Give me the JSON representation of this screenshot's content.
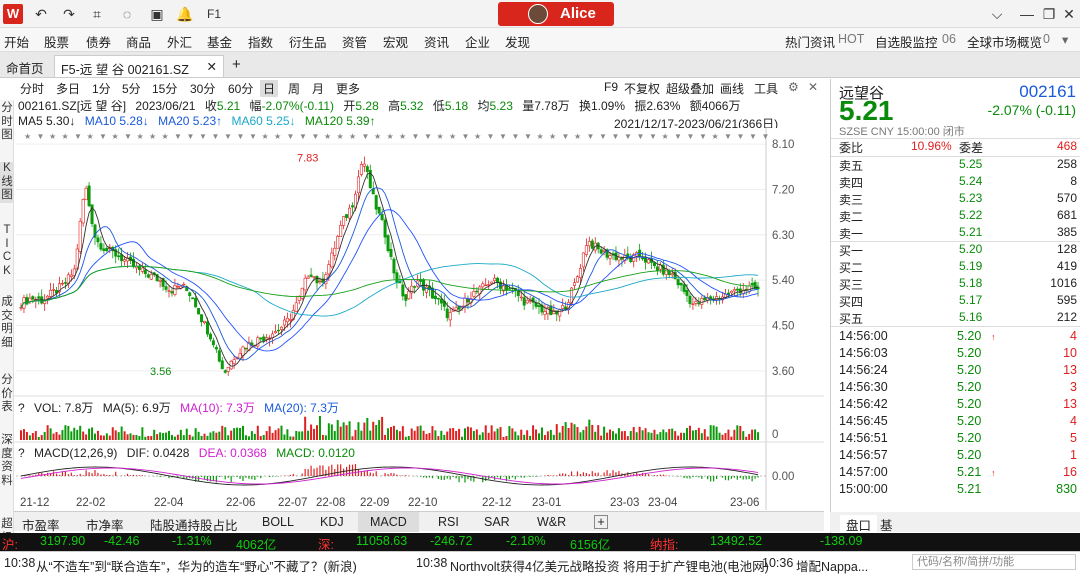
{
  "title_bar": {
    "logo": "W",
    "user_name": "Alice",
    "icons": [
      "undo-icon",
      "redo-icon",
      "crop-icon",
      "chat-icon",
      "window-icon",
      "bell-icon",
      "f1-icon"
    ],
    "f1_label": "F1"
  },
  "menu": {
    "items": [
      "开始",
      "股票",
      "债券",
      "商品",
      "外汇",
      "基金",
      "指数",
      "衍生品",
      "资管",
      "宏观",
      "资讯",
      "企业",
      "发现"
    ],
    "right": [
      "热门资讯",
      "HOT",
      "自选股监控",
      "06",
      "全球市场概览",
      "0"
    ]
  },
  "tabs": {
    "home": "命首页",
    "active": "F5-远 望 谷 002161.SZ",
    "add": "+"
  },
  "left_sidebar": [
    "分\n时\n图",
    "K\n线\n图",
    "T\nI\nC\nK",
    "成\n交\n明\n细",
    "分\n价\n表",
    "深\n度\n资\n料",
    "超\n级"
  ],
  "periods": [
    "分时",
    "多日",
    "1分",
    "5分",
    "15分",
    "30分",
    "60分",
    "日",
    "周",
    "月",
    "更多"
  ],
  "active_period": "日",
  "chart_tools": [
    "F9",
    "不复权",
    "超级叠加",
    "画线",
    "工具"
  ],
  "info_line": {
    "code": "002161.SZ[远 望 谷]",
    "date": "2023/06/21",
    "cur_lbl": "收",
    "cur": "5.21",
    "chg_lbl": "幅",
    "chg": "-2.07%(-0.11)",
    "open_lbl": "开",
    "open": "5.28",
    "high_lbl": "高",
    "high": "5.32",
    "low_lbl": "低",
    "low": "5.18",
    "avg_lbl": "均",
    "avg": "5.23",
    "vol_lbl": "量",
    "vol": "7.78万",
    "turn_lbl": "换",
    "turn": "1.09%",
    "amp_lbl": "振",
    "amp": "2.63%",
    "amt_lbl": "额",
    "amt": "4066万"
  },
  "ma_line": {
    "ma5": "MA5 5.30↓",
    "ma10": "MA10 5.28↓",
    "ma20": "MA20 5.23↑",
    "ma60": "MA60 5.25↓",
    "ma120": "MA120 5.39↑"
  },
  "range": "2021/12/17-2023/06/21(366日)",
  "vol_line": {
    "vol": "VOL: 7.8万",
    "ma5": "MA(5): 6.9万",
    "ma10": "MA(10): 7.3万",
    "ma20": "MA(20): 7.3万"
  },
  "macd_line": {
    "macd": "MACD(12,26,9)",
    "dif": "DIF: 0.0428",
    "dea": "DEA: 0.0368",
    "val": "MACD: 0.0120"
  },
  "chart_data": {
    "type": "candlestick",
    "y_ticks": [
      "8.10",
      "7.20",
      "6.30",
      "5.40",
      "4.50",
      "3.60"
    ],
    "y_range": [
      3.3,
      8.3
    ],
    "x_ticks": [
      "21-12",
      "22-02",
      "22-04",
      "22-06",
      "22-07",
      "22-08",
      "22-09",
      "22-10",
      "22-12",
      "23-01",
      "23-03",
      "23-04",
      "23-06"
    ],
    "annotations": [
      "7.83",
      "3.56"
    ],
    "close_path": [
      4.95,
      5.05,
      5.0,
      5.15,
      5.3,
      5.6,
      7.3,
      6.2,
      6.0,
      5.9,
      5.75,
      5.6,
      5.5,
      5.4,
      5.2,
      5.3,
      5.1,
      4.6,
      4.2,
      3.56,
      3.9,
      4.1,
      4.2,
      4.3,
      4.4,
      4.6,
      5.0,
      5.6,
      5.3,
      5.8,
      6.5,
      6.9,
      7.83,
      7.0,
      6.4,
      5.5,
      5.0,
      5.4,
      5.2,
      5.0,
      4.7,
      4.8,
      5.1,
      5.2,
      5.4,
      5.3,
      5.2,
      5.0,
      4.9,
      4.8,
      4.7,
      4.9,
      5.4,
      6.2,
      6.0,
      5.9,
      5.85,
      5.8,
      5.9,
      5.7,
      5.6,
      5.5,
      5.2,
      4.9,
      5.0,
      5.05,
      5.1,
      5.2,
      5.25,
      5.21
    ],
    "vol_axis": "0",
    "macd_axis": "0.00"
  },
  "right_panel": {
    "name": "远望谷",
    "code": "002161",
    "price": "5.21",
    "change": "-2.07% (-0.11)",
    "sub": "SZSE  CNY  15:00:00  闭市",
    "ratio_lbl": "委比",
    "ratio": "10.96%",
    "diff_lbl": "委差",
    "diff": "468",
    "asks": [
      {
        "l": "卖五",
        "p": "5.25",
        "v": "258"
      },
      {
        "l": "卖四",
        "p": "5.24",
        "v": "8"
      },
      {
        "l": "卖三",
        "p": "5.23",
        "v": "570"
      },
      {
        "l": "卖二",
        "p": "5.22",
        "v": "681"
      },
      {
        "l": "卖一",
        "p": "5.21",
        "v": "385"
      }
    ],
    "bids": [
      {
        "l": "买一",
        "p": "5.20",
        "v": "128"
      },
      {
        "l": "买二",
        "p": "5.19",
        "v": "419"
      },
      {
        "l": "买三",
        "p": "5.18",
        "v": "1016"
      },
      {
        "l": "买四",
        "p": "5.17",
        "v": "595"
      },
      {
        "l": "买五",
        "p": "5.16",
        "v": "212"
      }
    ],
    "ticks": [
      {
        "t": "14:56:00",
        "p": "5.20",
        "a": "↑",
        "v": "4"
      },
      {
        "t": "14:56:03",
        "p": "5.20",
        "a": "",
        "v": "10"
      },
      {
        "t": "14:56:24",
        "p": "5.20",
        "a": "",
        "v": "13"
      },
      {
        "t": "14:56:30",
        "p": "5.20",
        "a": "",
        "v": "3"
      },
      {
        "t": "14:56:42",
        "p": "5.20",
        "a": "",
        "v": "13"
      },
      {
        "t": "14:56:45",
        "p": "5.20",
        "a": "",
        "v": "4"
      },
      {
        "t": "14:56:51",
        "p": "5.20",
        "a": "",
        "v": "5"
      },
      {
        "t": "14:56:57",
        "p": "5.20",
        "a": "",
        "v": "1"
      },
      {
        "t": "14:57:00",
        "p": "5.21",
        "a": "↑",
        "v": "16"
      },
      {
        "t": "15:00:00",
        "p": "5.21",
        "a": "",
        "v": "830"
      }
    ],
    "tabs": [
      "盘口",
      "基"
    ]
  },
  "bottom_tabs": [
    "市盈率",
    "市净率",
    "陆股通持股占比",
    "BOLL",
    "KDJ",
    "MACD",
    "RSI",
    "SAR",
    "W&R",
    "+"
  ],
  "active_bottom": "MACD",
  "ticker": {
    "label": "沪:",
    "idx": "3197.90",
    "chg": "-42.46",
    "pct": "-1.31%",
    "amt": "4062亿",
    "label2": "深:",
    "idx2": "11058.63",
    "chg2": "-246.72",
    "pct2": "-2.18%",
    "amt2": "6156亿",
    "label3": "纳指:",
    "idx3": "13492.52",
    "chg3": "-138.09"
  },
  "news": [
    {
      "t": "10:38",
      "txt": "从“不造车”到“联合造车”，华为的造车“野心”不藏了？(新浪)"
    },
    {
      "t": "10:38",
      "txt": "Northvolt获得4亿美元战略投资 将用于扩产锂电池(电池网)"
    },
    {
      "t": "10:36",
      "txt": "增配Nappa..."
    }
  ],
  "news_search": "代码/名称/简拼/功能"
}
